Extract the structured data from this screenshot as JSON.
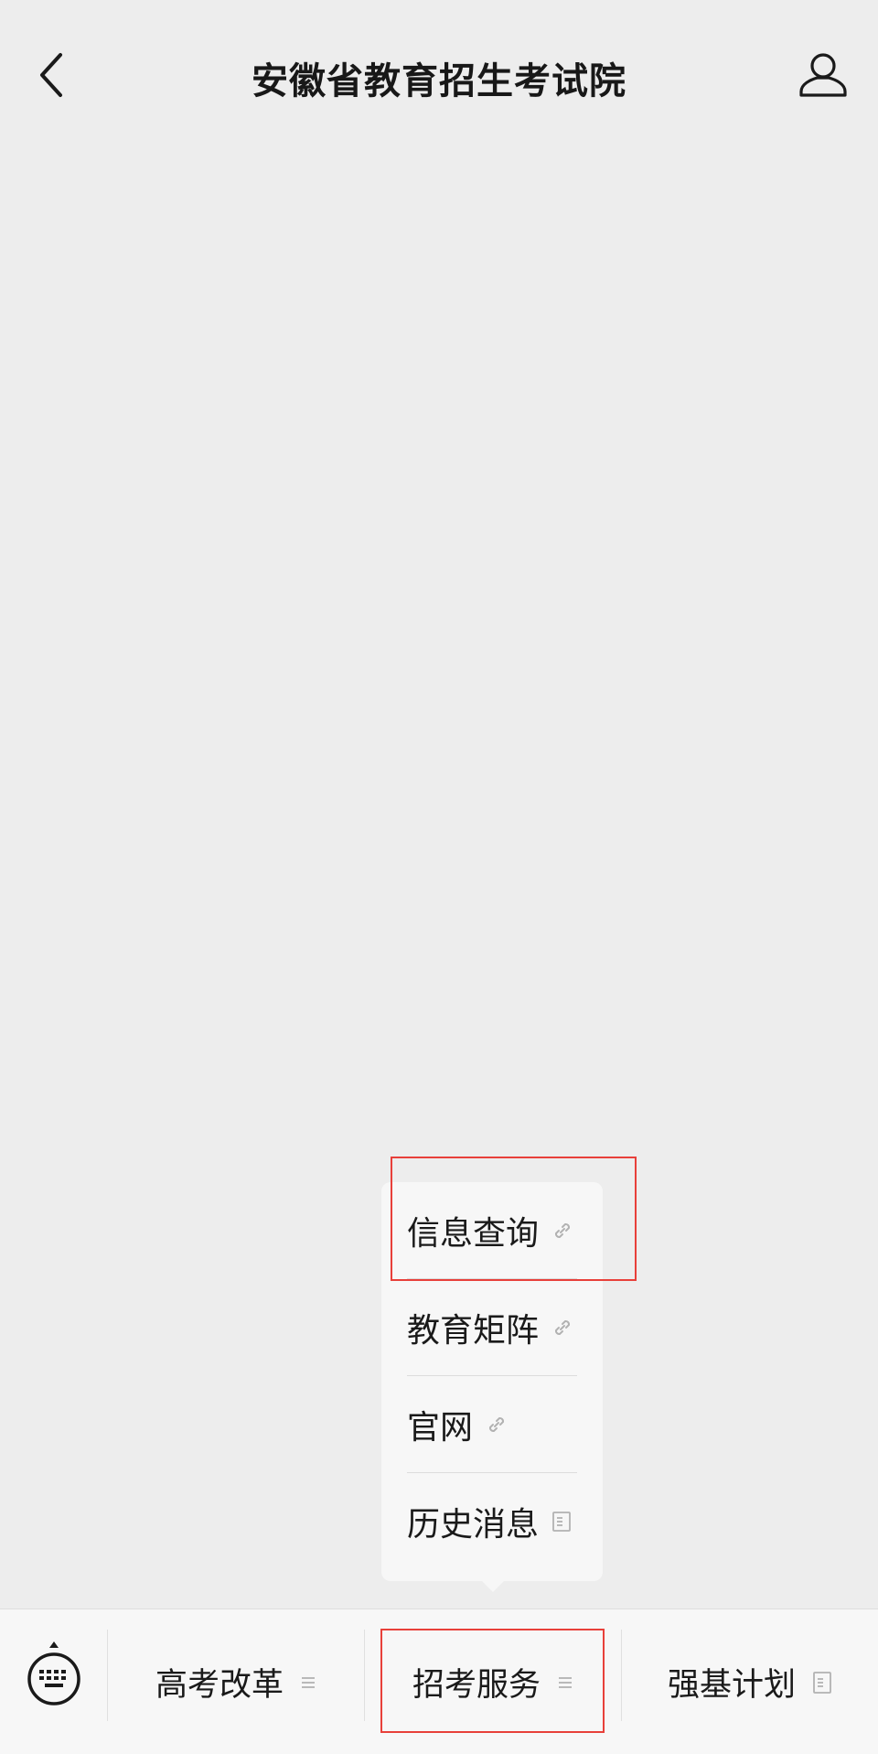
{
  "header": {
    "title": "安徽省教育招生考试院",
    "back_icon": "chevron-left-icon",
    "profile_icon": "person-icon"
  },
  "popup": {
    "items": [
      {
        "label": "信息查询",
        "icon": "link-icon"
      },
      {
        "label": "教育矩阵",
        "icon": "link-icon"
      },
      {
        "label": "官网",
        "icon": "link-icon"
      },
      {
        "label": "历史消息",
        "icon": "document-icon"
      }
    ]
  },
  "bottom_bar": {
    "keyboard_icon": "keyboard-icon",
    "tabs": [
      {
        "label": "高考改革",
        "icon": "menu-icon"
      },
      {
        "label": "招考服务",
        "icon": "menu-icon"
      },
      {
        "label": "强基计划",
        "icon": "document-icon"
      }
    ]
  },
  "colors": {
    "background": "#ededed",
    "bar": "#f7f7f7",
    "highlight": "#e8403a",
    "icon_gray": "#b2b2b2"
  }
}
